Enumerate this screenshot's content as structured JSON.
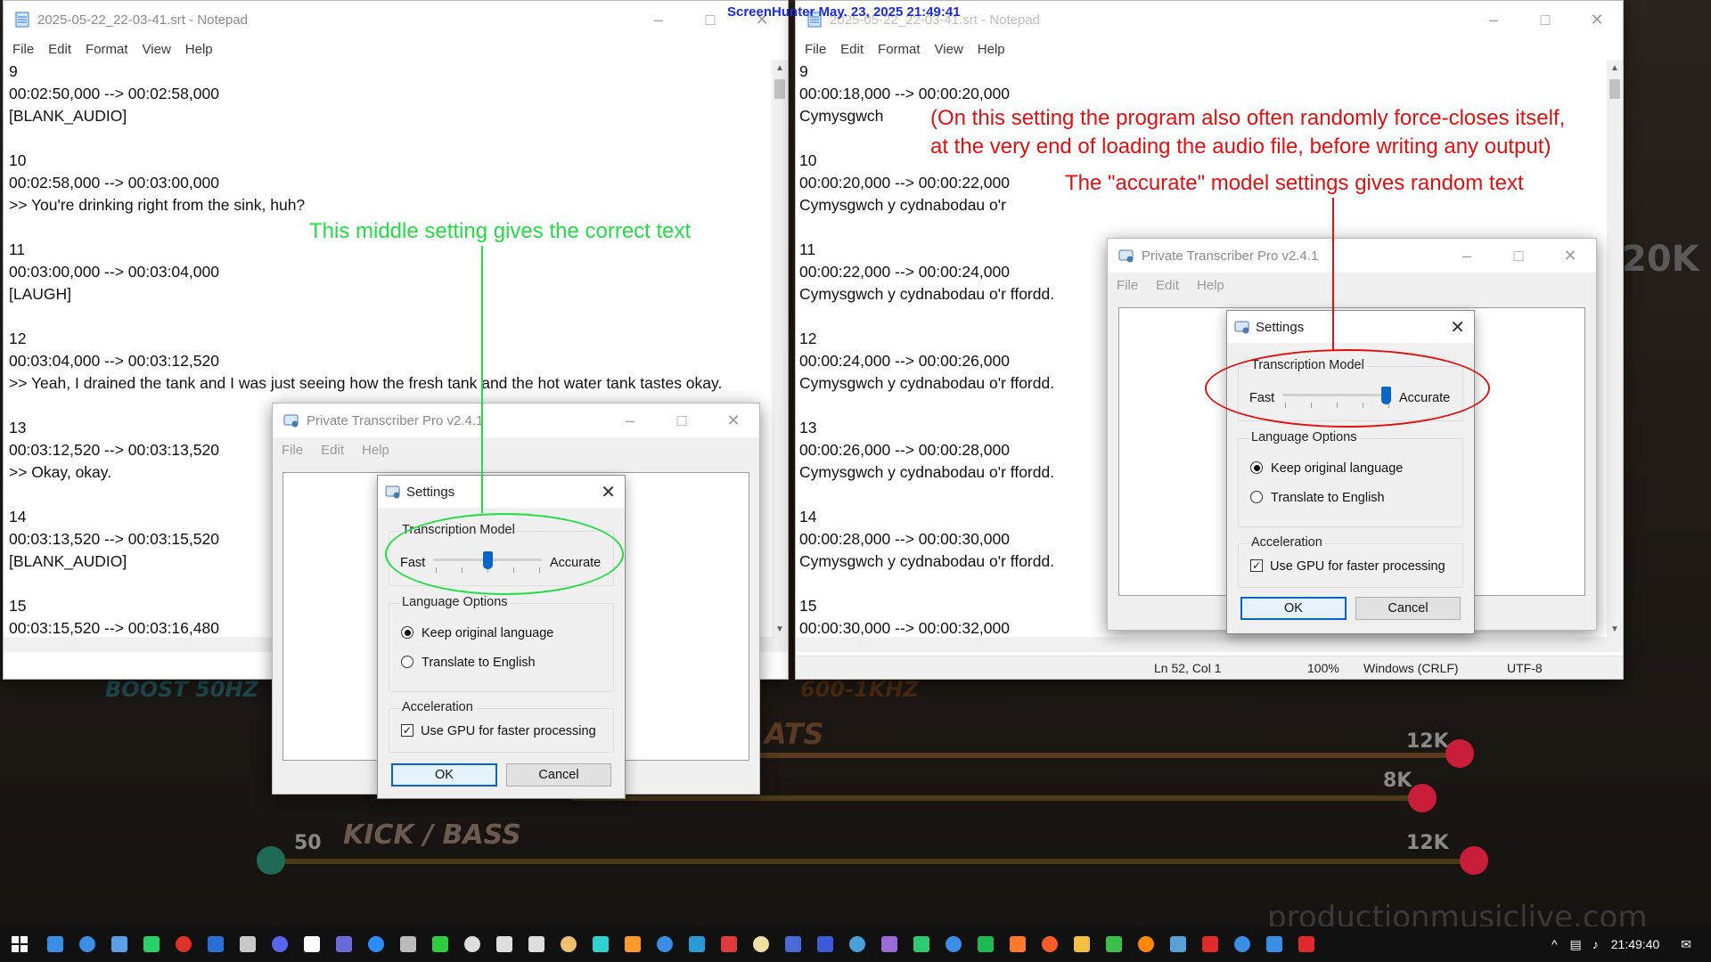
{
  "screenhunter": "ScreenHunter  May. 23, 2025  21:49:41",
  "notepad_left": {
    "title": "2025-05-22_22-03-41.srt - Notepad",
    "menu": [
      "File",
      "Edit",
      "Format",
      "View",
      "Help"
    ],
    "lines": [
      "9",
      "00:02:50,000 --> 00:02:58,000",
      "[BLANK_AUDIO]",
      "",
      "10",
      "00:02:58,000 --> 00:03:00,000",
      ">> You're drinking right from the sink, huh?",
      "",
      "11",
      "00:03:00,000 --> 00:03:04,000",
      "[LAUGH]",
      "",
      "12",
      "00:03:04,000 --> 00:03:12,520",
      ">> Yeah, I drained the tank and I was just seeing how the fresh tank and the hot water tank tastes okay.",
      "",
      "13",
      "00:03:12,520 --> 00:03:13,520",
      ">> Okay, okay.",
      "",
      "14",
      "00:03:13,520 --> 00:03:15,520",
      "[BLANK_AUDIO]",
      "",
      "15",
      "00:03:15,520 --> 00:03:16,480"
    ]
  },
  "notepad_right": {
    "title": "2025-05-22_22-03-41.srt - Notepad",
    "menu": [
      "File",
      "Edit",
      "Format",
      "View",
      "Help"
    ],
    "lines": [
      "9",
      "00:00:18,000 --> 00:00:20,000",
      "Cymysgwch",
      "",
      "10",
      "00:00:20,000 --> 00:00:22,000",
      "Cymysgwch y cydnabodau o'r",
      "",
      "11",
      "00:00:22,000 --> 00:00:24,000",
      "Cymysgwch y cydnabodau o'r ffordd.",
      "",
      "12",
      "00:00:24,000 --> 00:00:26,000",
      "Cymysgwch y cydnabodau o'r ffordd.",
      "",
      "13",
      "00:00:26,000 --> 00:00:28,000",
      "Cymysgwch y cydnabodau o'r ffordd.",
      "",
      "14",
      "00:00:28,000 --> 00:00:30,000",
      "Cymysgwch y cydnabodau o'r ffordd.",
      "",
      "15",
      "00:00:30,000 --> 00:00:32,000"
    ],
    "status": {
      "position": "Ln 52, Col 1",
      "zoom": "100%",
      "line_ending": "Windows (CRLF)",
      "encoding": "UTF-8"
    }
  },
  "transcriber_left": {
    "title": "Private Transcriber Pro v2.4.1",
    "menu": [
      "File",
      "Edit",
      "Help"
    ]
  },
  "transcriber_right": {
    "title": "Private Transcriber Pro v2.4.1",
    "menu": [
      "File",
      "Edit",
      "Help"
    ]
  },
  "settings_left": {
    "title": "Settings",
    "model_group": "Transcription Model",
    "slider_min": "Fast",
    "slider_max": "Accurate",
    "slider_value": 0.5,
    "language_group": "Language Options",
    "language_options": [
      "Keep original language",
      "Translate to English"
    ],
    "language_selected": 0,
    "accel_group": "Acceleration",
    "gpu_label": "Use GPU for faster processing",
    "gpu_checked": true,
    "ok": "OK",
    "cancel": "Cancel"
  },
  "settings_right": {
    "title": "Settings",
    "model_group": "Transcription Model",
    "slider_min": "Fast",
    "slider_max": "Accurate",
    "slider_value": 1.0,
    "language_group": "Language Options",
    "language_options": [
      "Keep original language",
      "Translate to English"
    ],
    "language_selected": 0,
    "accel_group": "Acceleration",
    "gpu_label": "Use GPU for faster processing",
    "gpu_checked": true,
    "ok": "OK",
    "cancel": "Cancel"
  },
  "annotations": {
    "middle": "This middle setting gives the correct text",
    "closes_line1": "(On this setting the program also often randomly force-closes itself,",
    "closes_line2": "at the very end of loading the audio file, before writing any output)",
    "accurate": "The \"accurate\" model settings gives random text",
    "green": "#22dd44",
    "red": "#e01010"
  },
  "background": {
    "boost": "BOOST 50HZ",
    "freq": "600-1KHZ",
    "beats": "ATS",
    "kick": "KICK / BASS",
    "k12a": "12K",
    "k8": "8K",
    "k12b": "12K",
    "n50": "50",
    "k20": "20K",
    "brand": "productionmusiclive.com"
  },
  "taskbar": {
    "time": "21:49:40",
    "icon_colors": [
      "#3a8ee6",
      "#3a8ee6",
      "#5aa0e8",
      "#25d366",
      "#e0322a",
      "#2a6fd6",
      "#c8c8c8",
      "#5865f2",
      "#ffffff",
      "#6a6ad8",
      "#2d8cff",
      "#bbbbbb",
      "#2ecc40",
      "#dddddd",
      "#dddddd",
      "#dddddd",
      "#f0c070",
      "#30d0d0",
      "#ff9a2a",
      "#3a8ee6",
      "#2a9ad6",
      "#e03a3a",
      "#f0e0a0",
      "#4a6ad8",
      "#3a5ad8",
      "#4aa0d8",
      "#9a6ad8",
      "#2ecc71",
      "#3a8ee6",
      "#1db954",
      "#ff7a2a",
      "#ff5a2a",
      "#f0c040",
      "#3ac04a",
      "#ff8800",
      "#5aa0d8",
      "#e02a2a",
      "#3a8ee6",
      "#3a8ee6",
      "#e02a2a"
    ]
  }
}
